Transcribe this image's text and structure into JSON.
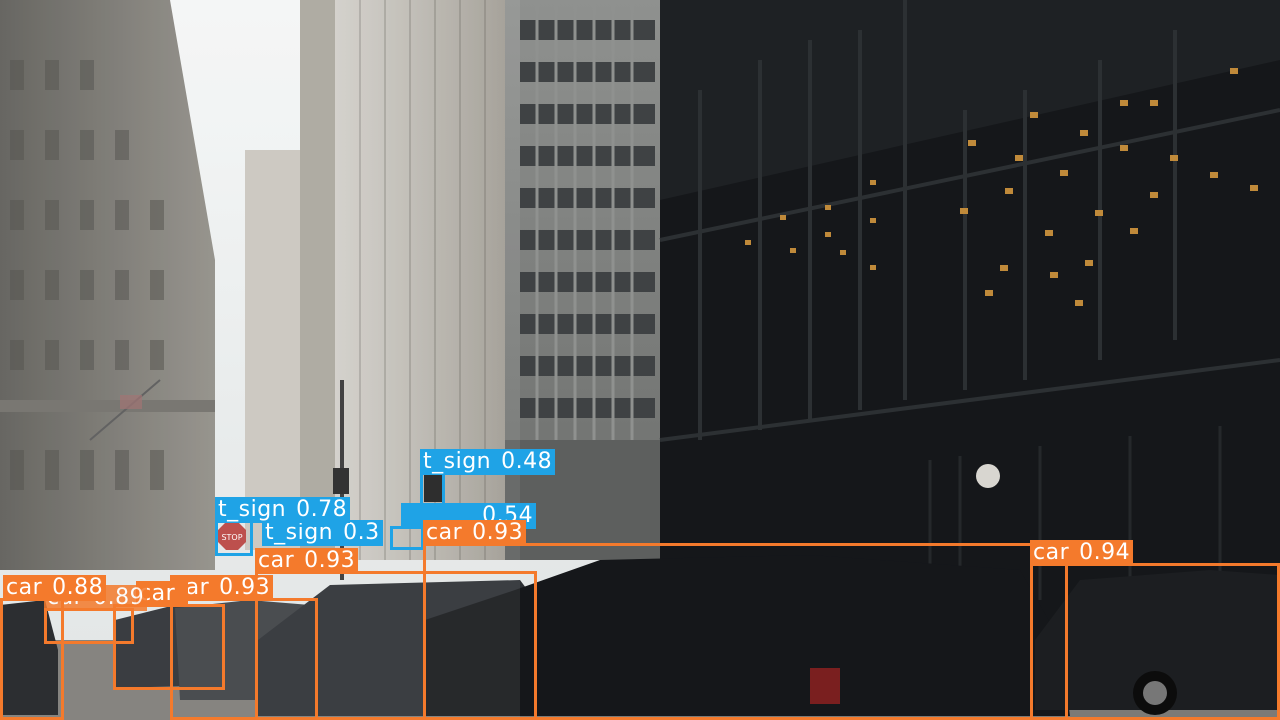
{
  "image": {
    "description_tags": [
      "street",
      "buildings",
      "object-detection"
    ]
  },
  "colors": {
    "car": "#f47a2c",
    "t_sign": "#1fa3e6",
    "sky": "#e9edee",
    "dark_building": "#15171a"
  },
  "detections": [
    {
      "cls": "t_sign",
      "conf": "0.48"
    },
    {
      "cls": "t_sign",
      "conf": "0.78"
    },
    {
      "cls": "t_sign",
      "conf": "0.54"
    },
    {
      "cls": "t_sign",
      "conf": "0.3"
    },
    {
      "cls": "car",
      "conf": "0.93"
    },
    {
      "cls": "car",
      "conf": "0.94"
    },
    {
      "cls": "car",
      "conf": "0.93"
    },
    {
      "cls": "car",
      "conf": "0.93"
    },
    {
      "cls": "car",
      "conf": "0.88"
    },
    {
      "cls": "car",
      "conf": "0.89"
    },
    {
      "cls": "car",
      "conf": ""
    }
  ],
  "stop_sign_text": "STOP"
}
